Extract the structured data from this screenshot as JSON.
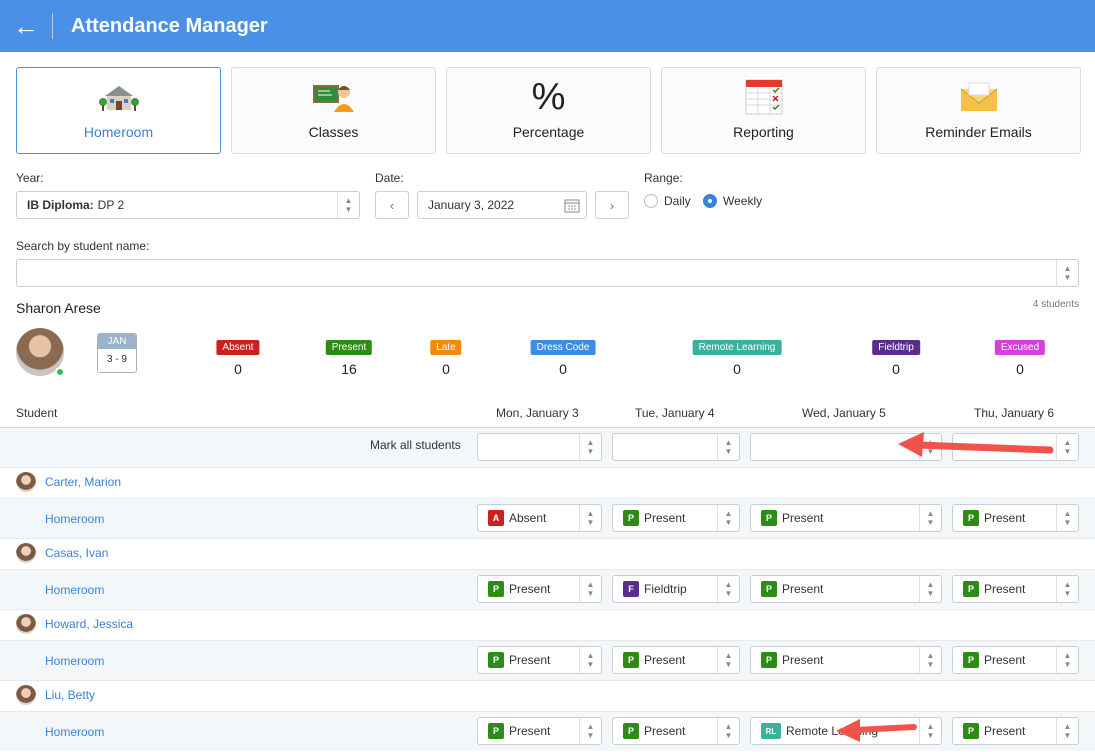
{
  "header": {
    "title": "Attendance Manager"
  },
  "tiles": [
    {
      "label": "Homeroom",
      "icon": "school-building-icon"
    },
    {
      "label": "Classes",
      "icon": "teacher-blackboard-icon"
    },
    {
      "label": "Percentage",
      "icon": "percent-icon",
      "glyph": "%"
    },
    {
      "label": "Reporting",
      "icon": "spreadsheet-checklist-icon"
    },
    {
      "label": "Reminder Emails",
      "icon": "envelope-icon"
    }
  ],
  "filters": {
    "year_label": "Year:",
    "year_prefix": "IB Diploma:",
    "year_value": "DP 2",
    "date_label": "Date:",
    "date_value": "January 3, 2022",
    "range_label": "Range:",
    "range_options": [
      "Daily",
      "Weekly"
    ],
    "range_selected": "Weekly",
    "search_label": "Search by student name:",
    "search_value": ""
  },
  "teacher": {
    "name": "Sharon Arese",
    "count": "4 students"
  },
  "calendar": {
    "month": "JAN",
    "days": "3 - 9"
  },
  "stats": [
    {
      "label": "Absent",
      "value": "0",
      "color": "#cc1f1f"
    },
    {
      "label": "Present",
      "value": "16",
      "color": "#2e8b18"
    },
    {
      "label": "Late",
      "value": "0",
      "color": "#f08b0c"
    },
    {
      "label": "Dress Code",
      "value": "0",
      "color": "#3d8ee0"
    },
    {
      "label": "Remote Learning",
      "value": "0",
      "color": "#3ab09e"
    },
    {
      "label": "Fieldtrip",
      "value": "0",
      "color": "#5a2d8c"
    },
    {
      "label": "Excused",
      "value": "0",
      "color": "#d63fd9"
    }
  ],
  "table": {
    "student_header": "Student",
    "days": [
      "Mon, January 3",
      "Tue, January 4",
      "Wed, January 5",
      "Thu, January 6"
    ],
    "mark_all_label": "Mark all students",
    "rows": [
      {
        "name": "Carter, Marion",
        "class": "Homeroom",
        "marks": [
          {
            "code": "A",
            "label": "Absent",
            "color": "#cc1f1f"
          },
          {
            "code": "P",
            "label": "Present",
            "color": "#2e8b18"
          },
          {
            "code": "P",
            "label": "Present",
            "color": "#2e8b18"
          },
          {
            "code": "P",
            "label": "Present",
            "color": "#2e8b18"
          }
        ]
      },
      {
        "name": "Casas, Ivan",
        "class": "Homeroom",
        "marks": [
          {
            "code": "P",
            "label": "Present",
            "color": "#2e8b18"
          },
          {
            "code": "F",
            "label": "Fieldtrip",
            "color": "#5a2d8c"
          },
          {
            "code": "P",
            "label": "Present",
            "color": "#2e8b18"
          },
          {
            "code": "P",
            "label": "Present",
            "color": "#2e8b18"
          }
        ]
      },
      {
        "name": "Howard, Jessica",
        "class": "Homeroom",
        "marks": [
          {
            "code": "P",
            "label": "Present",
            "color": "#2e8b18"
          },
          {
            "code": "P",
            "label": "Present",
            "color": "#2e8b18"
          },
          {
            "code": "P",
            "label": "Present",
            "color": "#2e8b18"
          },
          {
            "code": "P",
            "label": "Present",
            "color": "#2e8b18"
          }
        ]
      },
      {
        "name": "Liu, Betty",
        "class": "Homeroom",
        "marks": [
          {
            "code": "P",
            "label": "Present",
            "color": "#2e8b18"
          },
          {
            "code": "P",
            "label": "Present",
            "color": "#2e8b18"
          },
          {
            "code": "RL",
            "label": "Remote Learning",
            "color": "#3ab09e"
          },
          {
            "code": "P",
            "label": "Present",
            "color": "#2e8b18"
          }
        ]
      }
    ]
  },
  "annotations": {
    "arrow_color": "#f0524c"
  }
}
